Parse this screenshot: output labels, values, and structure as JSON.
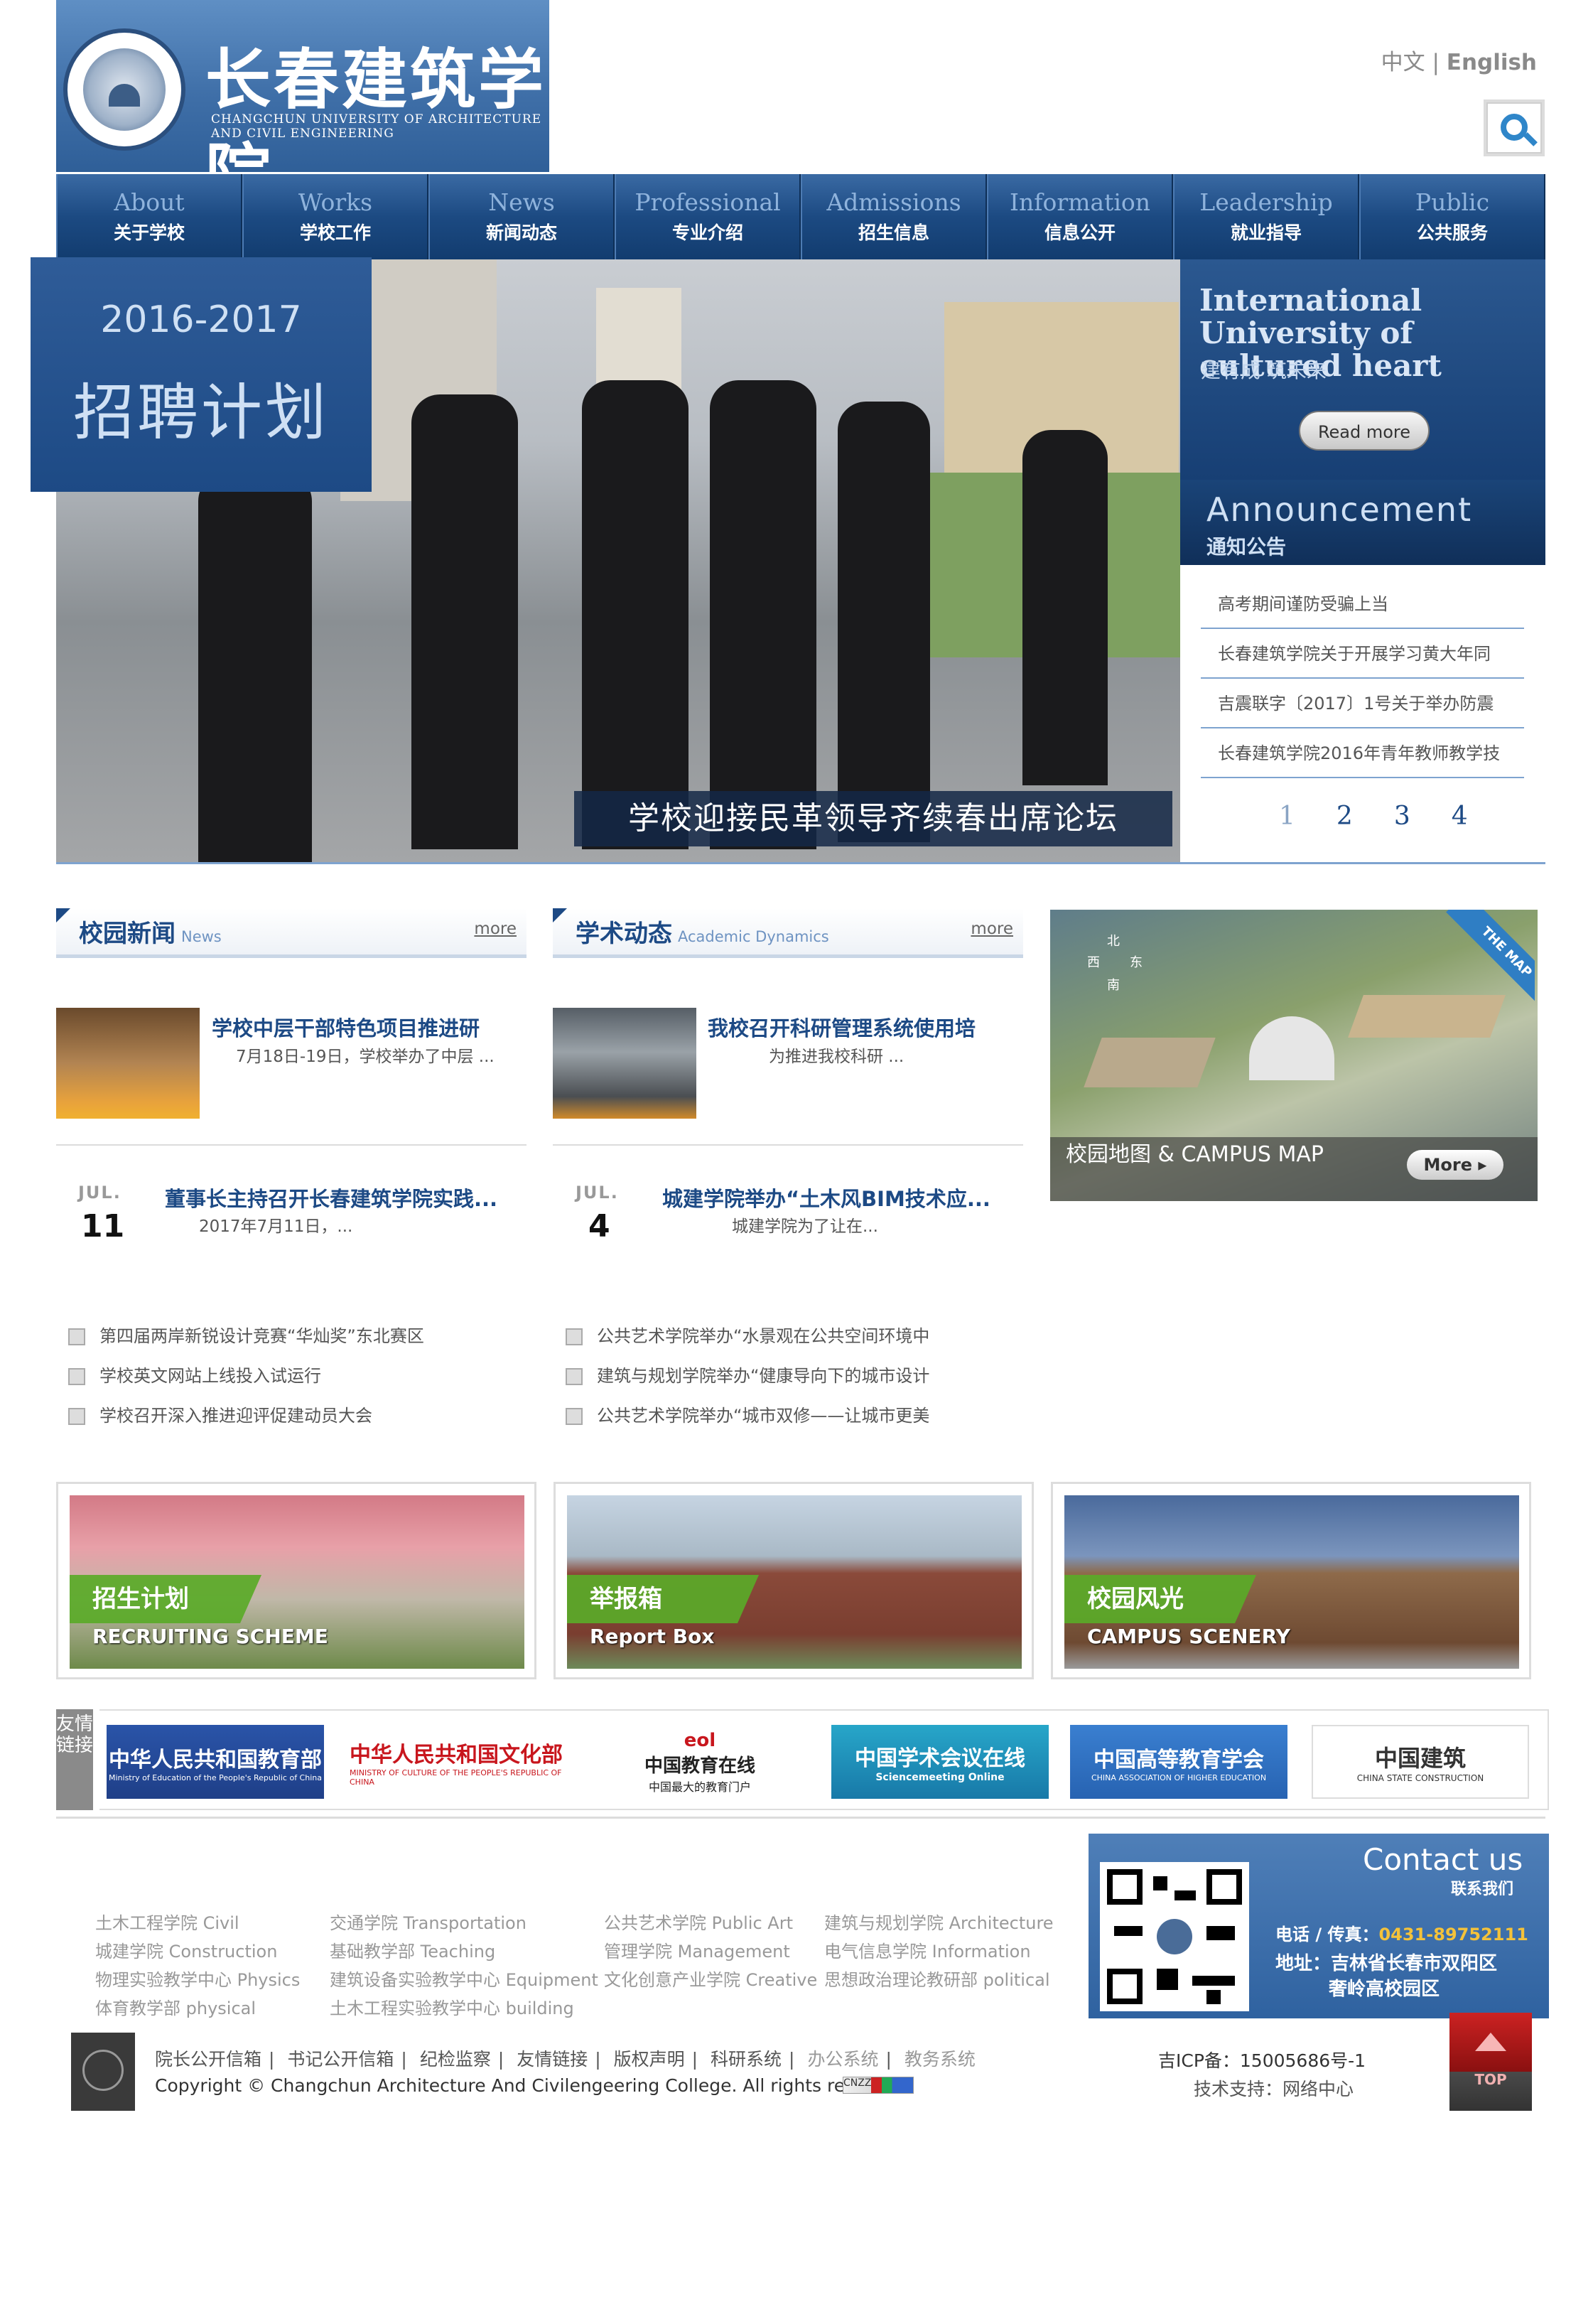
{
  "header": {
    "school_cn": "长春建筑学院",
    "school_en": "CHANGCHUN UNIVERSITY OF ARCHITECTURE AND CIVIL ENGINEERING",
    "lang_cn": "中文",
    "lang_sep": " | ",
    "lang_en": "English",
    "search_icon": "search-icon"
  },
  "nav": [
    {
      "en": "About",
      "cn": "关于学校"
    },
    {
      "en": "Works",
      "cn": "学校工作"
    },
    {
      "en": "News",
      "cn": "新闻动态"
    },
    {
      "en": "Professional",
      "cn": "专业介绍"
    },
    {
      "en": "Admissions",
      "cn": "招生信息"
    },
    {
      "en": "Information",
      "cn": "信息公开"
    },
    {
      "en": "Leadership",
      "cn": "就业指导"
    },
    {
      "en": "Public",
      "cn": "公共服务"
    }
  ],
  "hero": {
    "recruit_year": "2016-2017",
    "recruit_title": "招聘计划",
    "caption": "学校迎接民革领导齐续春出席论坛"
  },
  "intl": {
    "title": "International University of cultured heart",
    "subtitle": "建有成 筑未来",
    "read_more": "Read more"
  },
  "announcement": {
    "en": "Announcement",
    "cn": "通知公告",
    "items": [
      "高考期间谨防受骗上当",
      "长春建筑学院关于开展学习黄大年同",
      "吉震联字〔2017〕1号关于举办防震",
      "长春建筑学院2016年青年教师教学技"
    ],
    "pages": [
      "1",
      "2",
      "3",
      "4"
    ]
  },
  "campus_news": {
    "title": "校园新闻",
    "sub": "News",
    "more": "more",
    "featured": {
      "title": "学校中层干部特色项目推进研",
      "summary": "7月18日-19日，学校举办了中层 ..."
    },
    "dated": {
      "mon": "JUL.",
      "day": "11",
      "title": "董事长主持召开长春建筑学院实践...",
      "summary": "2017年7月11日，..."
    },
    "list": [
      "第四届两岸新锐设计竞赛“华灿奖”东北赛区",
      "学校英文网站上线投入试运行",
      "学校召开深入推进迎评促建动员大会"
    ]
  },
  "academic": {
    "title": "学术动态",
    "sub": "Academic Dynamics",
    "more": "more",
    "featured": {
      "title": "我校召开科研管理系统使用培",
      "summary": "为推进我校科研 ..."
    },
    "dated": {
      "mon": "JUL.",
      "day": "4",
      "title": "城建学院举办“土木风BIM技术应...",
      "summary": "城建学院为了让在..."
    },
    "list": [
      "公共艺术学院举办“水景观在公共空间环境中",
      "建筑与规划学院举办“健康导向下的城市设计",
      "公共艺术学院举办“城市双修——让城市更美"
    ]
  },
  "map": {
    "label": "校园地图 & CAMPUS MAP",
    "more": "More ▸",
    "ribbon": "THE MAP",
    "north": "北",
    "east": "东",
    "west": "西",
    "south": "南"
  },
  "promos": [
    {
      "cn": "招生计划",
      "en": "RECRUITING SCHEME"
    },
    {
      "cn": "举报箱",
      "en": "Report Box"
    },
    {
      "cn": "校园风光",
      "en": "CAMPUS SCENERY"
    }
  ],
  "links": {
    "label": "友情链接",
    "items": [
      {
        "text": "中华人民共和国教育部",
        "sub": "Ministry of Education of the People's Republic of China"
      },
      {
        "text": "中华人民共和国文化部",
        "sub": "MINISTRY OF CULTURE OF THE PEOPLE'S REPUBLIC OF CHINA"
      },
      {
        "text": "中国教育在线",
        "sub": "中国最大的教育门户"
      },
      {
        "text": "中国学术会议在线",
        "sub": "Sciencemeeting Online"
      },
      {
        "text": "中国高等教育学会",
        "sub": "CHINA ASSOCIATION OF HIGHER EDUCATION"
      },
      {
        "text": "中国建筑",
        "sub": "CHINA STATE CONSTRUCTION"
      }
    ]
  },
  "depts": [
    [
      "土木工程学院 Civil",
      "交通学院 Transportation",
      "公共艺术学院 Public Art",
      "建筑与规划学院 Architecture"
    ],
    [
      "城建学院 Construction",
      "基础教学部 Teaching",
      "管理学院 Management",
      "电气信息学院 Information"
    ],
    [
      "物理实验教学中心 Physics",
      "建筑设备实验教学中心 Equipment",
      "文化创意产业学院 Creative",
      "思想政治理论教研部 political"
    ],
    [
      "体育教学部 physical",
      "土木工程实验教学中心 building"
    ]
  ],
  "contact": {
    "title": "Contact us",
    "cn": "联系我们",
    "phone_label": "电话 / 传真：",
    "phone": "0431-89752111",
    "addr1": "地址：吉林省长春市双阳区",
    "addr2": "奢岭高校园区"
  },
  "footer": {
    "links": [
      "院长公开信箱",
      "书记公开信箱",
      "纪检监察",
      "友情链接",
      "版权声明",
      "科研系统",
      "办公系统",
      "教务系统"
    ],
    "copyright": "Copyright © Changchun Architecture And Civilengeering College. All rights reserved.",
    "cnzz": "CNZZ",
    "icp": "吉ICP备：15005686号-1",
    "support": "技术支持：网络中心",
    "top": "TOP"
  }
}
